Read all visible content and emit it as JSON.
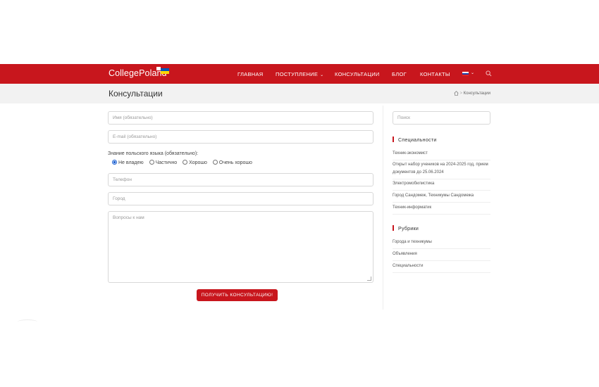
{
  "header": {
    "logo": "CollegePoland",
    "nav": [
      {
        "label": "ГЛАВНАЯ"
      },
      {
        "label": "ПОСТУПЛЕНИЕ"
      },
      {
        "label": "КОНСУЛЬТАЦИИ"
      },
      {
        "label": "БЛОГ"
      },
      {
        "label": "КОНТАКТЫ"
      }
    ],
    "colors": {
      "brand": "#c8161d"
    }
  },
  "titlebar": {
    "title": "Консультации",
    "breadcrumb": [
      "Консультации"
    ],
    "breadcrumb_sep": ">"
  },
  "form": {
    "name_placeholder": "Имя (обязательно)",
    "email_placeholder": "E-mail (обязательно)",
    "language_label": "Знание польского языка (обязательно):",
    "language_options": [
      "Не владею",
      "Частично",
      "Хорошо",
      "Очень хорошо"
    ],
    "language_selected": "Не владею",
    "phone_placeholder": "Телефон",
    "city_placeholder": "Город",
    "questions_placeholder": "Вопросы к нам",
    "submit_label": "ПОЛУЧИТЬ КОНСУЛЬТАЦИЮ!"
  },
  "sidebar": {
    "search_placeholder": "Поиск",
    "specialties_title": "Специальности",
    "specialties": [
      "Техник-экономист",
      "Открыт набор учеников на 2024-2025 год, прием документов до 25.06.2024",
      "Электромобилистика",
      "Город Сандомеж, Техникумы Сандомежа",
      "Техник-информатик"
    ],
    "rubrics_title": "Рубрики",
    "rubrics": [
      "Города и техникумы",
      "Объявления",
      "Специальности"
    ]
  }
}
